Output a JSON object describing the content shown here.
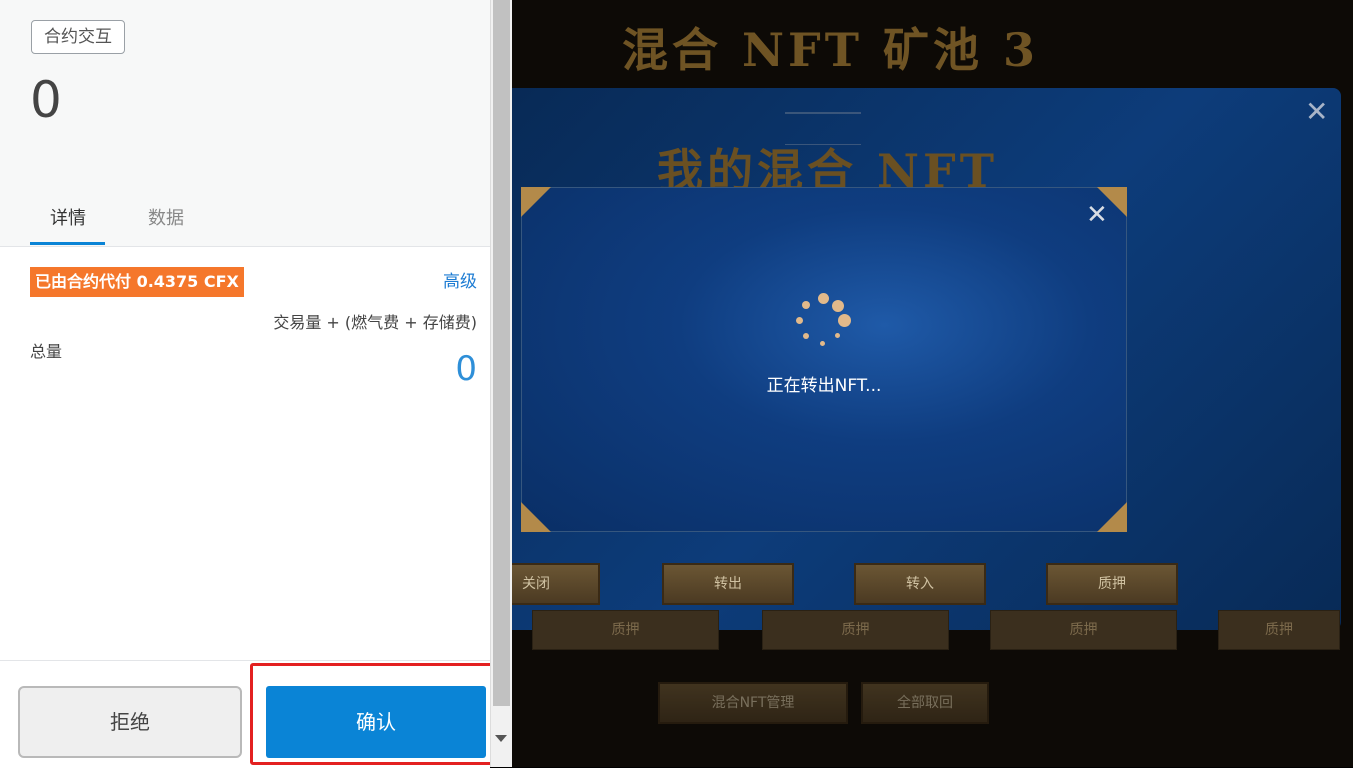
{
  "wallet": {
    "tag": "合约交互",
    "amount": "0",
    "tabs": {
      "details": "详情",
      "data": "数据"
    },
    "sponsor_text": "已由合约代付 0.4375 CFX",
    "advanced_label": "高级",
    "formula": "交易量 + (燃气费 + 存储费)",
    "total_label": "总量",
    "total_value": "0",
    "buttons": {
      "reject": "拒绝",
      "confirm": "确认"
    }
  },
  "game": {
    "title": "混合 NFT 矿池 3",
    "panel_title": "我的混合 NFT",
    "buttons": {
      "close": "关闭",
      "transfer_out": "转出",
      "transfer_in": "转入",
      "stake": "质押"
    },
    "bottom_buttons": {
      "manage": "混合NFT管理",
      "withdraw_all": "全部取回"
    },
    "faint_buttons": [
      "质押",
      "质押",
      "质押",
      "质押"
    ],
    "modal": {
      "loading_text": "正在转出NFT..."
    }
  },
  "colors": {
    "confirm_blue": "#0a84d6",
    "sponsor_orange": "#f5772b",
    "highlight_red": "#e32020",
    "link_blue": "#1d7cd3"
  }
}
